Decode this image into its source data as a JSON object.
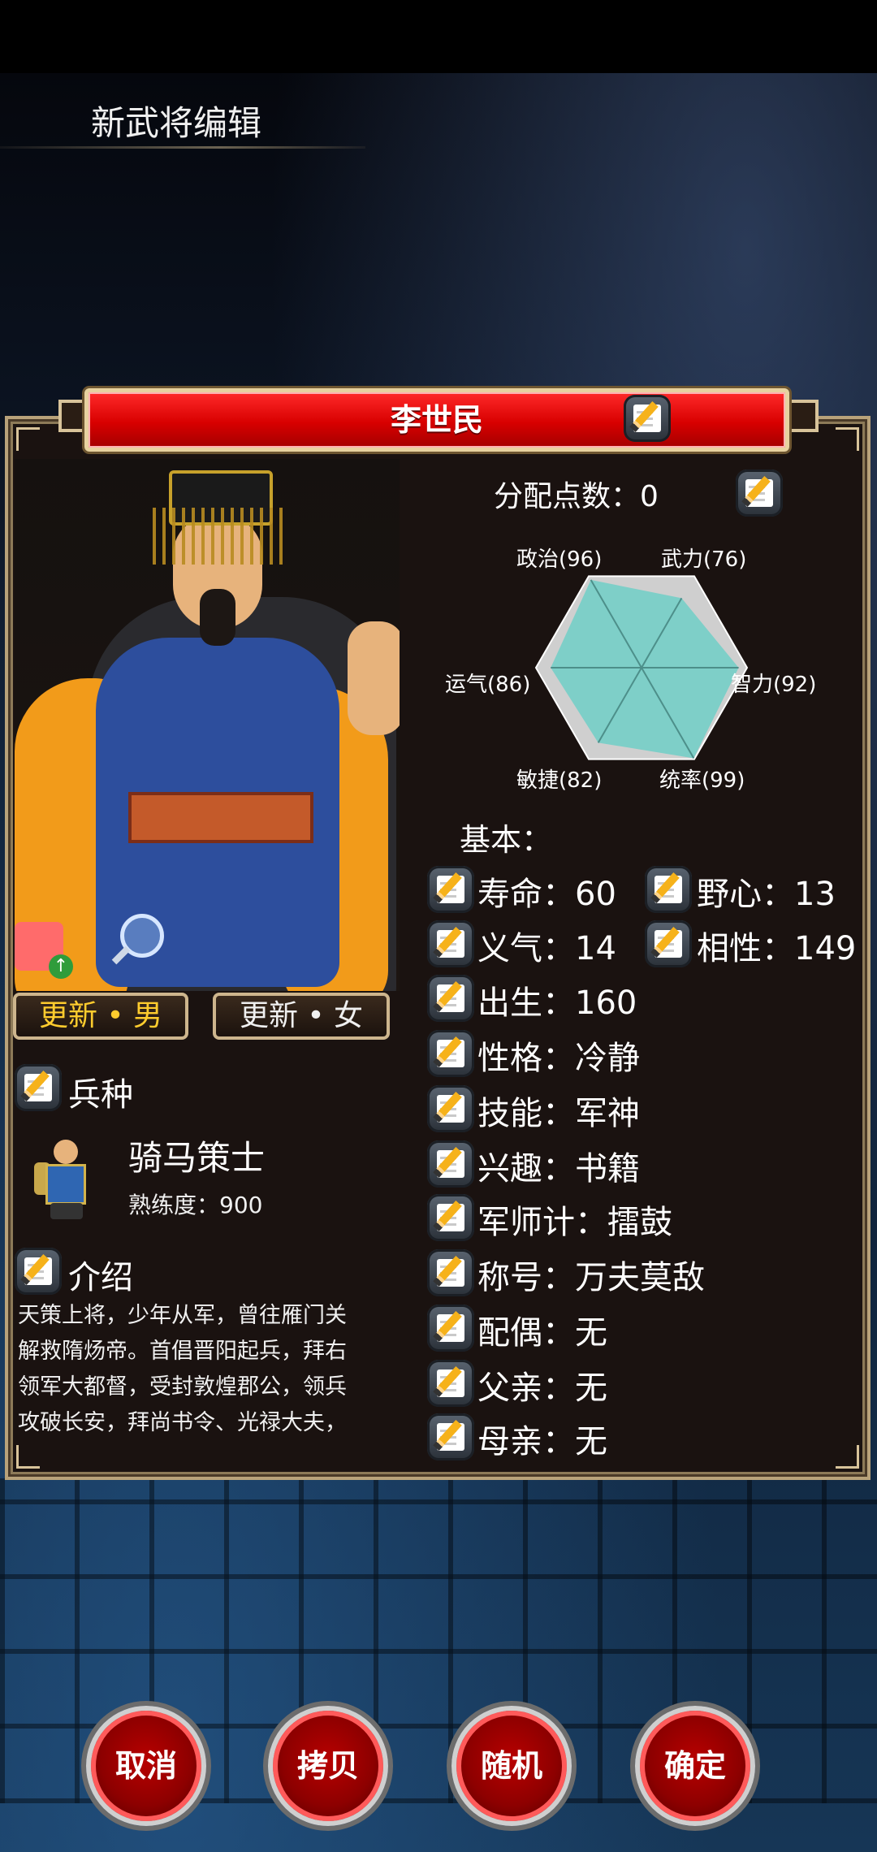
{
  "screen_title": "新武将编辑",
  "general": {
    "name": "李世民",
    "update_male": "更新 • 男",
    "update_female": "更新 • 女"
  },
  "troop": {
    "label": "兵种",
    "unit_name": "骑马策士",
    "proficiency": "熟练度：900"
  },
  "intro": {
    "label": "介绍",
    "text": "天策上将，少年从军，曾往雁门关\n解救隋炀帝。首倡晋阳起兵，拜右\n领军大都督，受封敦煌郡公，领兵\n攻破长安，拜尚书令、光禄大夫，"
  },
  "allocation": {
    "label": "分配点数：",
    "value": "0"
  },
  "radar": {
    "labels": [
      "政治(96)",
      "武力(76)",
      "智力(92)",
      "统率(99)",
      "敏捷(82)",
      "运气(86)"
    ],
    "values": [
      96,
      76,
      92,
      99,
      82,
      86
    ],
    "max": 100,
    "colors": {
      "fill": "#7ecfc8",
      "outer": "#cfcfcf",
      "lines": "#4d8f8a"
    }
  },
  "basic": {
    "label": "基本：",
    "lifespan": "寿命：60",
    "ambition": "野心：13",
    "loyalty": "义气：14",
    "affinity": "相性：149",
    "birth": "出生：160",
    "personality": "性格：冷静",
    "skill": "技能：军神",
    "hobby": "兴趣：书籍",
    "strategy": "军师计：擂鼓",
    "honor": "称号：万夫莫敌",
    "spouse": "配偶：无",
    "father": "父亲：无",
    "mother": "母亲：无"
  },
  "buttons": {
    "cancel": "取消",
    "copy": "拷贝",
    "random": "随机",
    "confirm": "确定"
  },
  "colors": {
    "name_bar": "#d80000",
    "gold_text": "#ffcc2e",
    "panel_border": "#b8a27a"
  }
}
